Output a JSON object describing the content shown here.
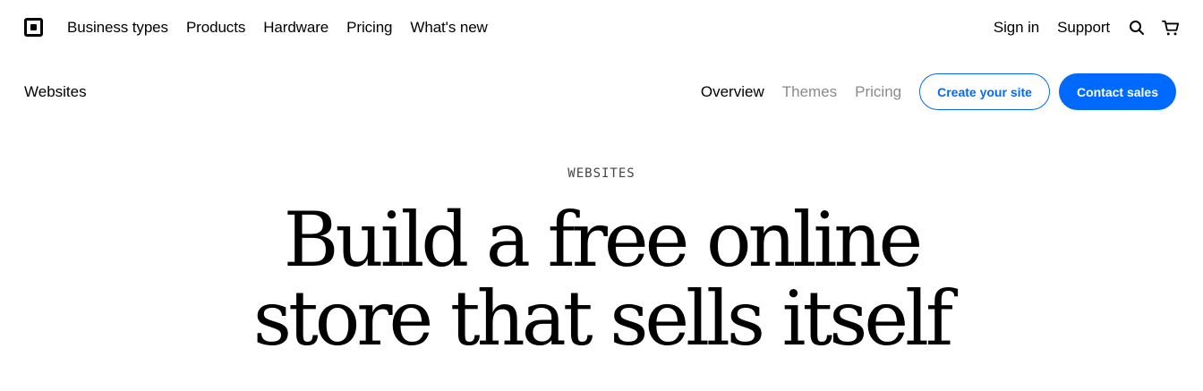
{
  "topnav": {
    "links": [
      "Business types",
      "Products",
      "Hardware",
      "Pricing",
      "What's new"
    ],
    "right_links": [
      "Sign in",
      "Support"
    ],
    "icons": [
      "search-icon",
      "cart-icon"
    ]
  },
  "subnav": {
    "title": "Websites",
    "tabs": [
      {
        "label": "Overview",
        "active": true
      },
      {
        "label": "Themes",
        "active": false
      },
      {
        "label": "Pricing",
        "active": false
      }
    ],
    "outline_button": "Create your site",
    "primary_button": "Contact sales"
  },
  "hero": {
    "eyebrow": "WEBSITES",
    "headline_line1": "Build a free online",
    "headline_line2": "store that sells itself"
  },
  "colors": {
    "accent": "#006aff",
    "inactive_tab": "#8a8a8a"
  }
}
